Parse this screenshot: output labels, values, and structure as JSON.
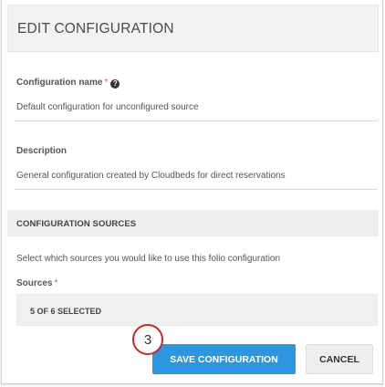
{
  "dialog": {
    "title": "EDIT CONFIGURATION"
  },
  "fields": {
    "config_name": {
      "label": "Configuration name",
      "required_marker": "*",
      "help_icon": "?",
      "value": "Default configuration for unconfigured source"
    },
    "description": {
      "label": "Description",
      "value": "General configuration created by Cloudbeds for direct reservations"
    }
  },
  "sources_section": {
    "title": "CONFIGURATION SOURCES",
    "description": "Select which sources you would like to use this folio configuration",
    "sources_label": "Sources",
    "required_marker": "*",
    "selected_value": "5 OF 6 SELECTED"
  },
  "buttons": {
    "save_label": "SAVE CONFIGURATION",
    "cancel_label": "CANCEL"
  },
  "annotation": {
    "step_number": "3",
    "color": "#c62828"
  },
  "colors": {
    "primary": "#2e96e0",
    "required": "#e05252"
  }
}
